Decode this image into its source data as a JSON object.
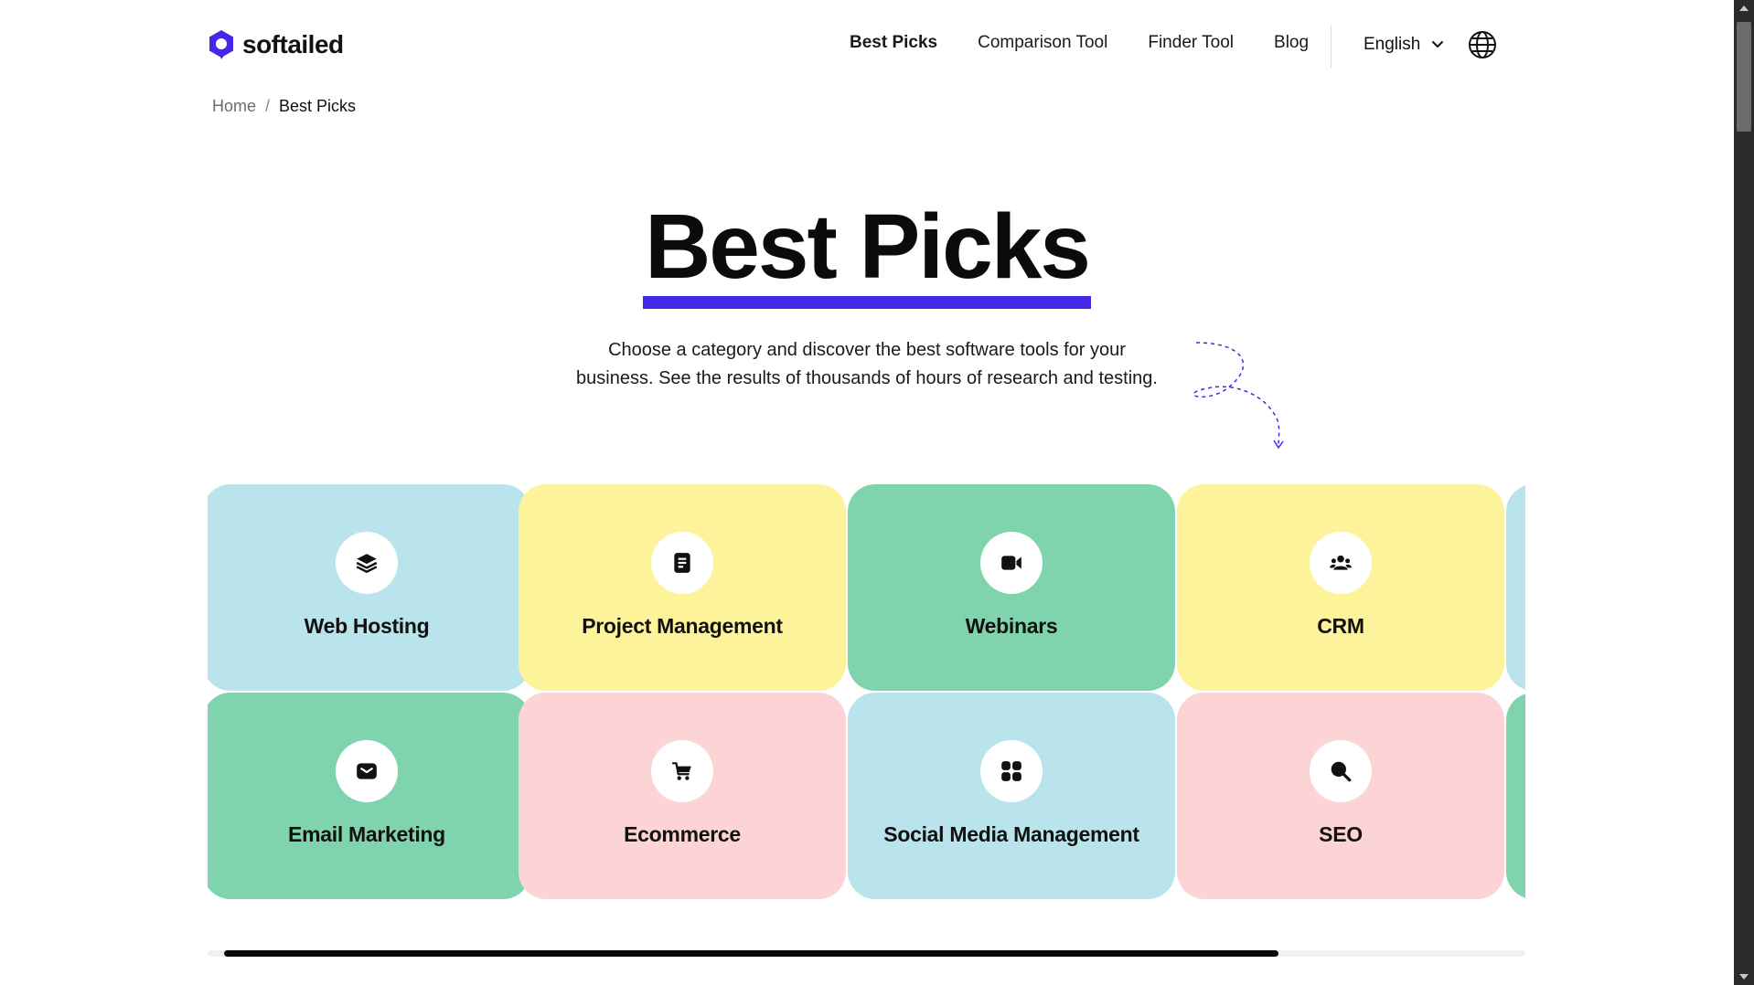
{
  "brand": {
    "name": "softailed",
    "accent": "#4328e6"
  },
  "nav": {
    "items": [
      {
        "label": "Best Picks",
        "active": true
      },
      {
        "label": "Comparison Tool",
        "active": false
      },
      {
        "label": "Finder Tool",
        "active": false
      },
      {
        "label": "Blog",
        "active": false
      }
    ],
    "language": "English"
  },
  "breadcrumb": {
    "home": "Home",
    "separator": "/",
    "current": "Best Picks"
  },
  "hero": {
    "title": "Best Picks",
    "description_line1": "Choose a category and discover the best software tools for your",
    "description_line2": "business. See the results of thousands of hours of research and testing."
  },
  "categories": [
    {
      "label": "Web Hosting",
      "icon": "layers-icon",
      "color": "#b9e4ec"
    },
    {
      "label": "Project Management",
      "icon": "document-icon",
      "color": "#fdf39b"
    },
    {
      "label": "Webinars",
      "icon": "video-camera-icon",
      "color": "#7fd4ad"
    },
    {
      "label": "CRM",
      "icon": "users-icon",
      "color": "#fdf39b"
    },
    {
      "label": "Email Marketing",
      "icon": "envelope-icon",
      "color": "#7fd4ad"
    },
    {
      "label": "Ecommerce",
      "icon": "cart-icon",
      "color": "#fcd4d5"
    },
    {
      "label": "Social Media Management",
      "icon": "apps-grid-icon",
      "color": "#b9e4ec"
    },
    {
      "label": "SEO",
      "icon": "search-icon",
      "color": "#fcd4d5"
    }
  ],
  "carousel": {
    "scroll_position_fraction": 0.81
  }
}
